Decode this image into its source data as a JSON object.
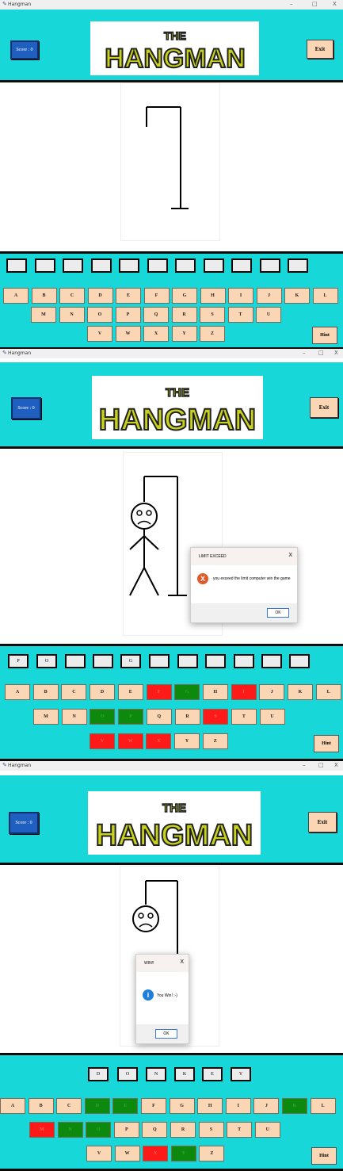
{
  "app": {
    "title": "Hangman",
    "minimize": "–",
    "maximize": "□",
    "close": "X"
  },
  "header": {
    "score_label": "Score : 0",
    "exit_label": "Exit",
    "logo_the": "THE",
    "logo_text": "HANGMAN"
  },
  "keyboard": {
    "row1": [
      "A",
      "B",
      "C",
      "D",
      "E",
      "F",
      "G",
      "H",
      "I",
      "J",
      "K",
      "L"
    ],
    "row2": [
      "M",
      "N",
      "O",
      "P",
      "Q",
      "R",
      "S",
      "T",
      "U"
    ],
    "row3": [
      "V",
      "W",
      "X",
      "Y",
      "Z"
    ],
    "hint_label": "Hint"
  },
  "screens": [
    {
      "slots": [
        "",
        "",
        "",
        "",
        "",
        "",
        "",
        "",
        "",
        "",
        ""
      ],
      "key_states": {},
      "dialog": null
    },
    {
      "slots": [
        "P",
        "O",
        "",
        "",
        "G",
        "",
        "",
        "",
        "",
        "",
        ""
      ],
      "key_states": {
        "F": "red",
        "G": "green",
        "I": "red",
        "O": "green",
        "P": "green",
        "S": "red",
        "V": "red",
        "W": "red",
        "X": "red"
      },
      "dialog": {
        "title": "LIMIT EXCEED",
        "message": "you exceed the limit computer win the game",
        "ok": "OK",
        "close": "X",
        "icon": "error-icon",
        "icon_glyph": "X"
      }
    },
    {
      "slots": [
        "D",
        "O",
        "N",
        "K",
        "E",
        "Y"
      ],
      "key_states": {
        "D": "green",
        "E": "green",
        "K": "green",
        "M": "red",
        "N": "green",
        "O": "green",
        "X": "red",
        "Y": "green"
      },
      "dialog": {
        "title": "WIN!!",
        "message": "You Win! :-)",
        "ok": "OK",
        "close": "X",
        "icon": "info-icon",
        "icon_glyph": "i"
      }
    }
  ],
  "colors": {
    "background": "#17d7d9",
    "key": "#fbd6b5",
    "wrong": "#ff1a1a",
    "correct": "#0d8a0d",
    "score_button": "#1f5fbf"
  }
}
